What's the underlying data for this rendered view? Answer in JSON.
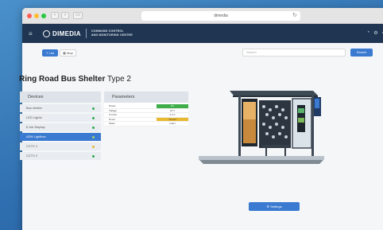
{
  "browser": {
    "url": "dimedia",
    "nav_back": "‹",
    "nav_fwd": "›",
    "sidebar_icon": "▭",
    "reload_icon": "↻",
    "share_icon": "⇪",
    "dots": [
      "#ff5f57",
      "#febc2e",
      "#28c840"
    ]
  },
  "app": {
    "menu_icon": "≡",
    "brand": "DIMEDIA",
    "subtitle_line1": "COMMAND CONTROL",
    "subtitle_line2": "AND MONITORING CENTER",
    "icon1": "◔",
    "icon2": "⚙",
    "icon3": "⚙"
  },
  "toolbar": {
    "list_label": "≡ List",
    "map_label": "▦ Map",
    "search_placeholder": "Search",
    "search_button": "Search"
  },
  "page": {
    "title_bold": "Ring Road Bus Shelter",
    "title_rest": " Type 2"
  },
  "devices": {
    "header": "Devices",
    "items": [
      {
        "label": "Bus shelter",
        "status_color": "#2eaa4f",
        "active": false
      },
      {
        "label": "LED Lights",
        "status_color": "#2eaa4f",
        "active": false
      },
      {
        "label": "E-Ink Display",
        "status_color": "#2eaa4f",
        "active": false
      },
      {
        "label": "ADN Lightbox",
        "status_color": "#9ad36a",
        "active": true
      },
      {
        "label": "CCTV 1",
        "status_color": "#e5b52a",
        "active": false
      },
      {
        "label": "CCTV 2",
        "status_color": "#2eaa4f",
        "active": false
      }
    ]
  },
  "parameters": {
    "header": "Parameters",
    "rows": [
      {
        "key": "Power",
        "value": "On",
        "bg": "#3fae4a",
        "fg": "#fff"
      },
      {
        "key": "Voltage",
        "value": "22 V",
        "bg": "#fff",
        "fg": "#444"
      },
      {
        "key": "Current",
        "value": "2.2 A",
        "bg": "#fff",
        "fg": "#444"
      },
      {
        "key": "Doors",
        "value": "Closed",
        "bg": "#e8b92e",
        "fg": "#444"
      },
      {
        "key": "Glass",
        "value": "Intact",
        "bg": "#fff",
        "fg": "#444"
      }
    ]
  },
  "settings": {
    "label": "⚙ Settings"
  }
}
